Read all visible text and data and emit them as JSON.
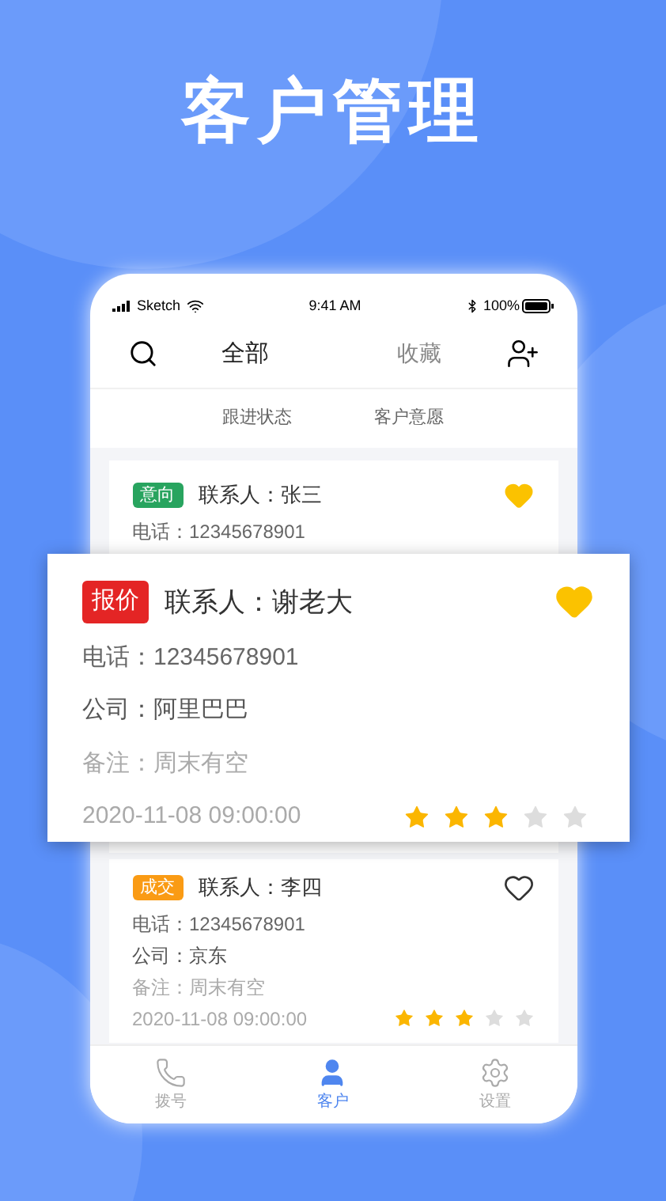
{
  "title": "客户管理",
  "status_bar": {
    "carrier": "Sketch",
    "time": "9:41 AM",
    "battery": "100%"
  },
  "top_tabs": [
    {
      "label": "全部",
      "selected": true
    },
    {
      "label": "收藏",
      "selected": false
    }
  ],
  "filters": [
    "跟进状态",
    "客户意愿"
  ],
  "customers": [
    {
      "tag": "意向",
      "color": "#28a45f",
      "contact": "联系人：张三",
      "favorite": true,
      "phone": "电话：12345678901"
    },
    {
      "tag": "成交",
      "color": "#fa9b14",
      "contact": "联系人：李四",
      "favorite": false,
      "phone": "电话：12345678901",
      "company": "公司：京东",
      "note": "备注：周末有空",
      "time": "2020-11-08 09:00:00",
      "stars": 3
    }
  ],
  "popup_card": {
    "tag": "报价",
    "color": "#e42525",
    "contact": "联系人：谢老大",
    "favorite": true,
    "phone": "电话：12345678901",
    "company": "公司：阿里巴巴",
    "note": "备注：周末有空",
    "time": "2020-11-08 09:00:00",
    "stars": 3
  },
  "bottom_nav": [
    {
      "kind": "phone",
      "label": "拨号",
      "selected": false
    },
    {
      "kind": "person",
      "label": "客户",
      "selected": true
    },
    {
      "kind": "gear",
      "label": "设置",
      "selected": false
    }
  ]
}
